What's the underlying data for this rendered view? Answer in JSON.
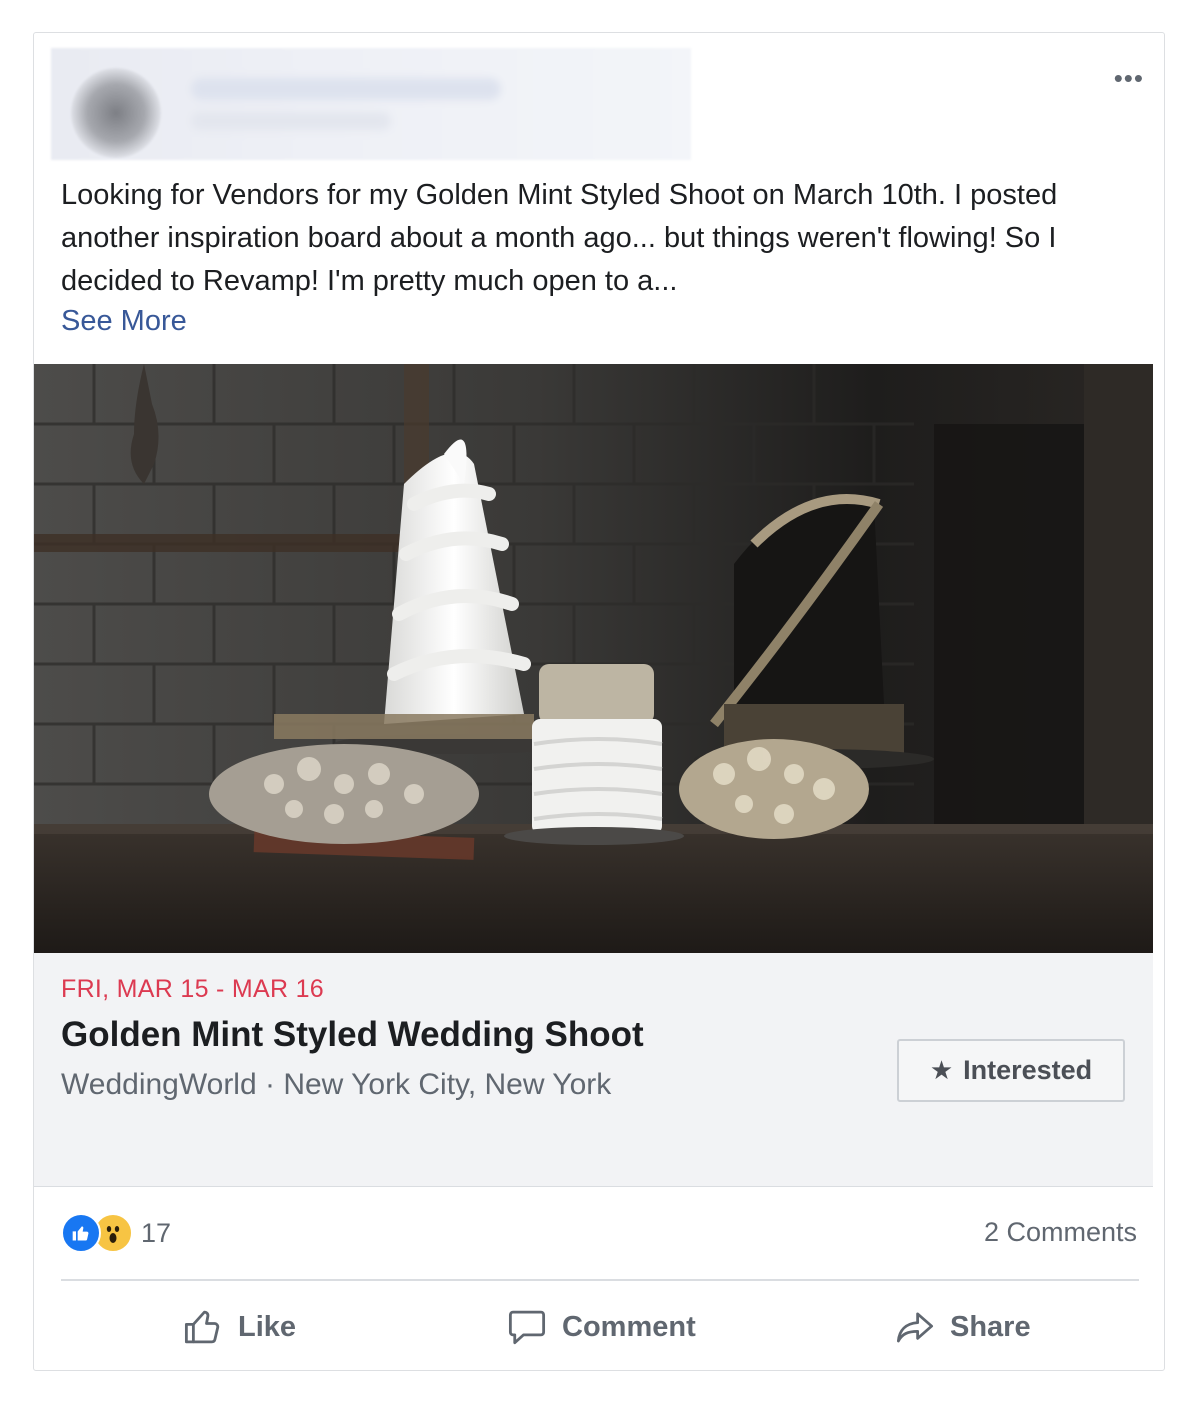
{
  "post": {
    "more_label": "•••",
    "text": "Looking for Vendors for my Golden Mint Styled Shoot on March 10th. I posted another inspiration board about a month ago... but things weren't flowing! So I decided to Revamp! I'm pretty much open to a...",
    "see_more": "See More"
  },
  "event": {
    "date": "FRI, MAR 15 - MAR 16",
    "title": "Golden Mint Styled Wedding Shoot",
    "meta": "WeddingWorld · New York City, New York",
    "interested_label": "Interested"
  },
  "stats": {
    "reaction_count": "17",
    "comments": "2 Comments"
  },
  "actions": {
    "like": "Like",
    "comment": "Comment",
    "share": "Share"
  },
  "colors": {
    "link": "#385898",
    "event_date": "#dc3a51",
    "like_blue": "#1877f2"
  }
}
